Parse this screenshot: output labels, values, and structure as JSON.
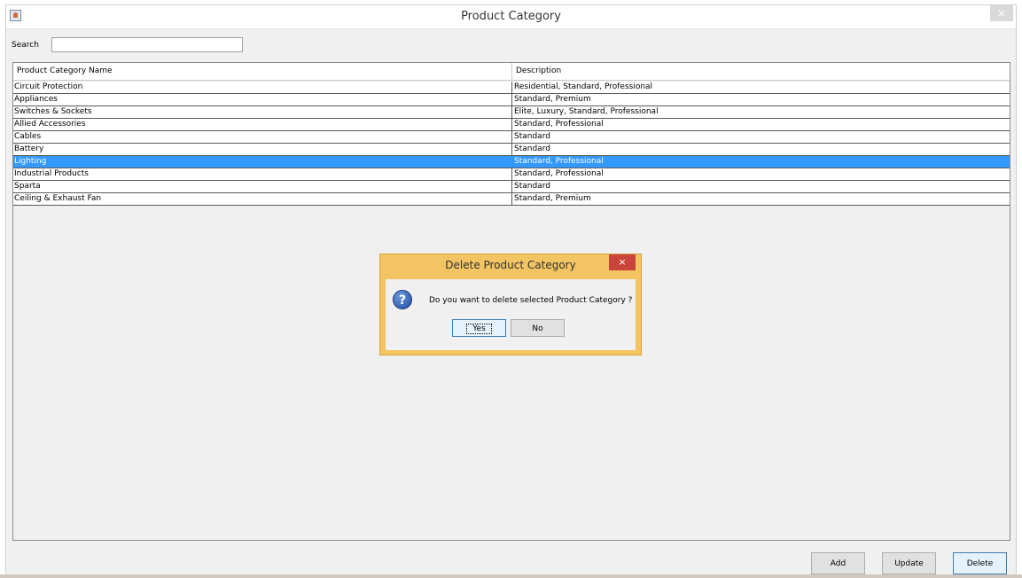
{
  "window": {
    "title": "Product Category",
    "close_glyph": "×"
  },
  "search": {
    "label": "Search",
    "value": ""
  },
  "table": {
    "columns": [
      "Product Category Name",
      "Description"
    ],
    "selected_index": 6,
    "rows": [
      [
        "Circuit Protection",
        "Residential, Standard, Professional"
      ],
      [
        "Appliances",
        "Standard, Premium"
      ],
      [
        "Switches & Sockets",
        "Elite, Luxury, Standard, Professional"
      ],
      [
        "Allied Accessories",
        "Standard, Professional"
      ],
      [
        "Cables",
        "Standard"
      ],
      [
        "Battery",
        "Standard"
      ],
      [
        "Lighting",
        "Standard, Professional"
      ],
      [
        "Industrial Products",
        "Standard, Professional"
      ],
      [
        "Sparta",
        "Standard"
      ],
      [
        "Ceiling & Exhaust Fan",
        "Standard, Premium"
      ]
    ]
  },
  "buttons": {
    "add": "Add",
    "update": "Update",
    "delete": "Delete"
  },
  "dialog": {
    "title": "Delete Product Category",
    "close_glyph": "×",
    "icon": "question-icon",
    "icon_glyph": "?",
    "message": "Do you want to delete selected Product Category ?",
    "yes": "Yes",
    "no": "No"
  },
  "colors": {
    "selection": "#3399ff",
    "dialog_frame": "#f3c462",
    "dialog_close": "#c9443b"
  }
}
